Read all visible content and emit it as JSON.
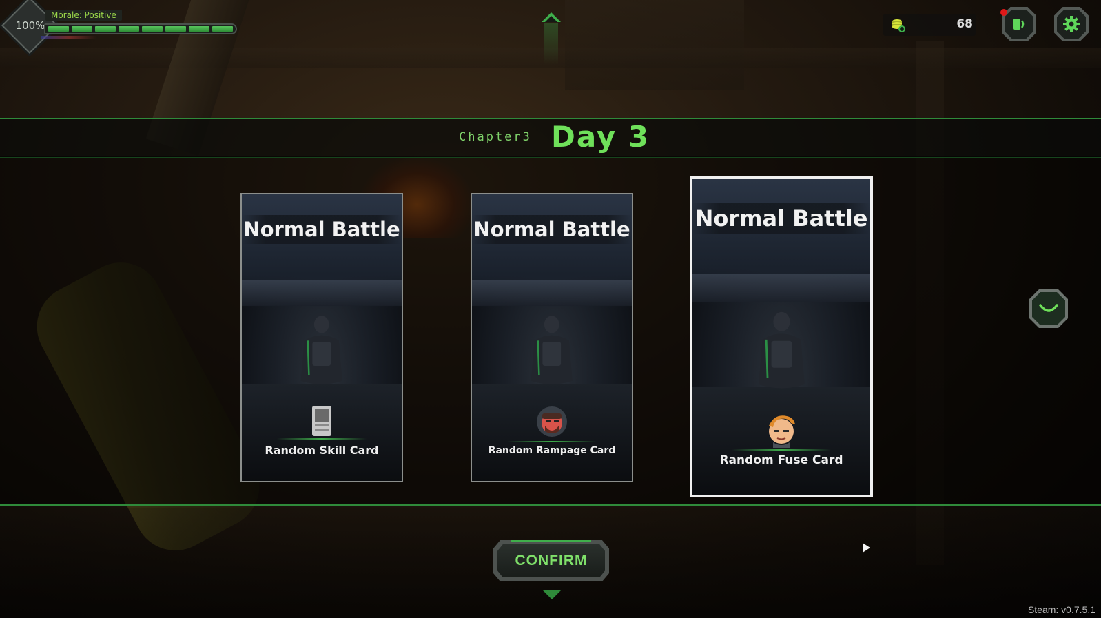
{
  "hud": {
    "morale_percent": "100%",
    "morale_label": "Morale: Positive",
    "morale_level": 1.0,
    "morale_segments": 8,
    "coins": "68",
    "notification_badge": true
  },
  "chapter": {
    "label": "Chapter3",
    "day": "Day 3"
  },
  "cards": [
    {
      "title": "Normal Battle",
      "reward": "Random Skill Card",
      "reward_icon": "skill-card-icon",
      "selected": false
    },
    {
      "title": "Normal Battle",
      "reward": "Random Rampage Card",
      "reward_icon": "rampage-face-icon",
      "selected": false
    },
    {
      "title": "Normal Battle",
      "reward": "Random Fuse Card",
      "reward_icon": "fuse-face-icon",
      "selected": true
    }
  ],
  "confirm_label": "CONFIRM",
  "version": "Steam: v0.7.5.1",
  "colors": {
    "accent_green": "#6fe05a",
    "band_border": "#2f8a3a",
    "selected_border": "#f0f0f0",
    "badge_red": "#e01818"
  }
}
